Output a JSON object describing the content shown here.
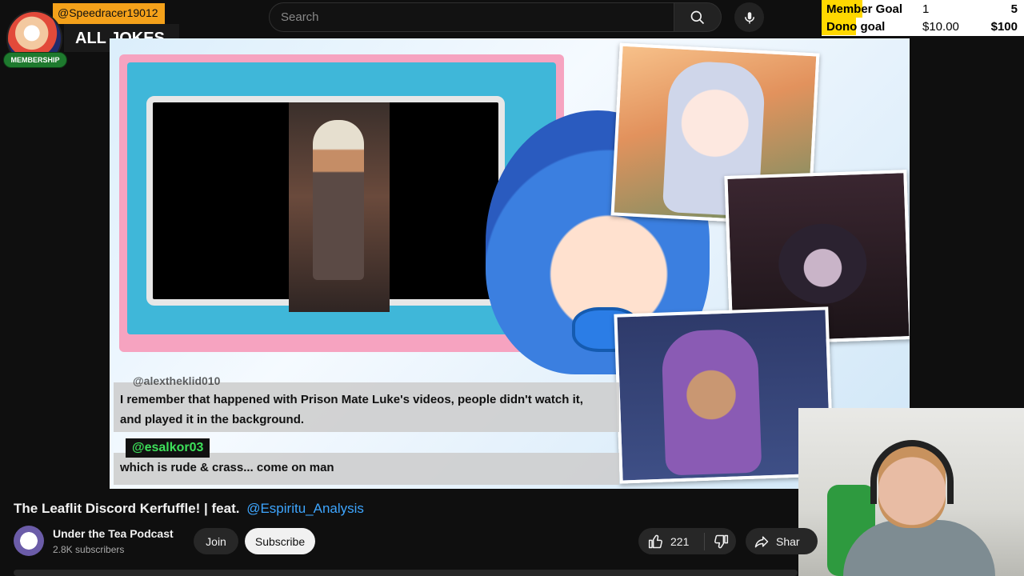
{
  "search": {
    "placeholder": "Search"
  },
  "icons": {
    "search": "search-icon",
    "mic": "microphone-icon",
    "like": "thumbs-up-icon",
    "dislike": "thumbs-down-icon",
    "share": "share-icon"
  },
  "overlay": {
    "username": "@Speedracer19012",
    "title": "ALL JOKES",
    "membership": "MEMBERSHIP"
  },
  "goals": [
    {
      "label": "Member Goal",
      "current": "1",
      "target": "5",
      "progress": 0.2
    },
    {
      "label": "Dono goal",
      "current": "$10.00",
      "target": "$100",
      "progress": 0.1
    }
  ],
  "chat": [
    {
      "handle_partial": "@alextheklid010",
      "text_line1": "I remember that happened with Prison Mate Luke's videos, people didn't watch it,",
      "text_line2": "and played it in the background."
    },
    {
      "handle": "@esalkor03",
      "text": "which is rude & crass... come on man"
    }
  ],
  "video": {
    "title": "The Leaflit Discord Kerfuffle! | feat.",
    "mention": "@Espiritu_Analysis"
  },
  "channel": {
    "name": "Under the Tea Podcast",
    "subscribers": "2.8K subscribers"
  },
  "actions": {
    "join": "Join",
    "subscribe": "Subscribe",
    "likes": "221",
    "share": "Shar"
  },
  "colors": {
    "accent_link": "#3ea6ff",
    "goal_bar": "#ffd800",
    "handle_green": "#3de05a",
    "username_badge": "#f4a11a"
  }
}
